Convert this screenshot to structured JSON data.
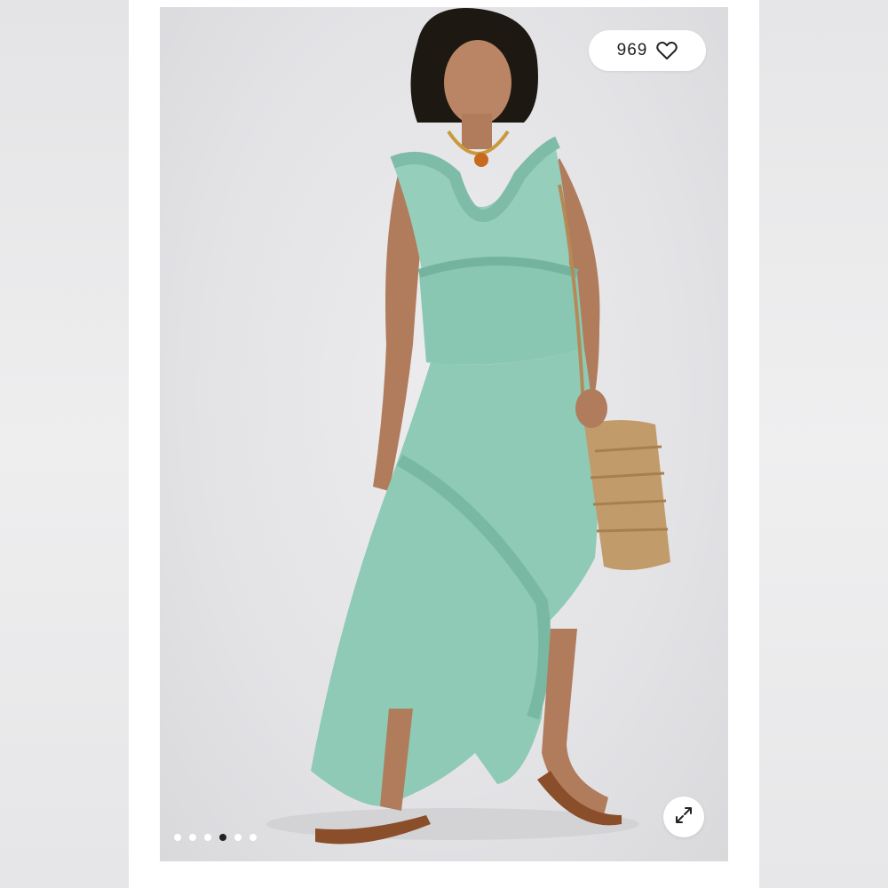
{
  "listing": {
    "likes_count": "969",
    "like_icon": "heart-outline-icon",
    "expand_icon": "expand-arrows-icon"
  },
  "carousel": {
    "total_images": 6,
    "active_index": 3
  },
  "colors": {
    "dress": "#8fc9b5",
    "background": "#e6e6e8",
    "active_dot": "#222222"
  }
}
